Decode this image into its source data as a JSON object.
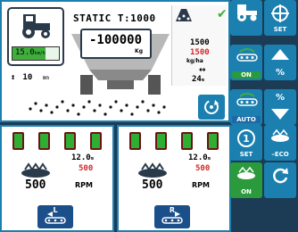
{
  "status": {
    "title": "STATIC T:1000"
  },
  "tractor": {
    "speed_value": "15.0",
    "speed_unit": "km/h",
    "speed_fill": 0.72
  },
  "working_width": {
    "value": "10",
    "unit": "mm"
  },
  "hopper": {
    "weight": "-100000",
    "weight_unit": "Kg"
  },
  "rate": {
    "actual": "1500",
    "target": "1500",
    "unit": "kg/ha",
    "throw_width": "24",
    "throw_unit": "m"
  },
  "left_disc": {
    "sections_on": 4,
    "width": "12.0",
    "width_unit": "m",
    "target": "500",
    "rpm": "500",
    "rpm_unit": "RPM",
    "button_letter": "L"
  },
  "right_disc": {
    "sections_on": 4,
    "width": "12.0",
    "width_unit": "m",
    "target": "500",
    "rpm": "500",
    "rpm_unit": "RPM",
    "button_letter": "R"
  },
  "side_buttons": {
    "tractor_label": "",
    "set_label": "SET",
    "on_label": "ON",
    "plus_label": "%",
    "auto_label": "AUTO",
    "minus_label": "%",
    "set2_label": "SET",
    "eco_label": "ECO",
    "on2_label": "ON"
  },
  "colors": {
    "accent": "#1b7fb0",
    "active": "#2fae34",
    "alert": "#d62626",
    "background": "#1c3b54"
  }
}
